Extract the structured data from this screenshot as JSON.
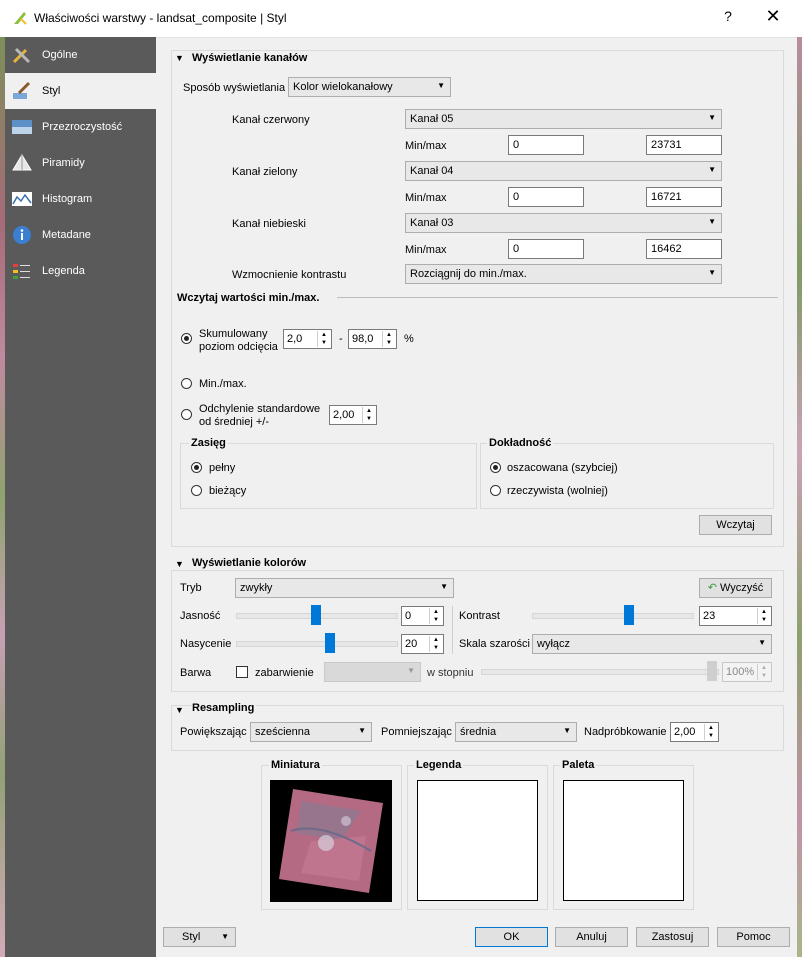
{
  "window": {
    "title": "Właściwości warstwy - landsat_composite | Styl",
    "help": "?",
    "close": "✕"
  },
  "sidebar": {
    "items": [
      {
        "label": "Ogólne",
        "icon": "tools-icon"
      },
      {
        "label": "Styl",
        "icon": "paintbrush-icon"
      },
      {
        "label": "Przezroczystość",
        "icon": "transparency-icon"
      },
      {
        "label": "Piramidy",
        "icon": "pyramid-icon"
      },
      {
        "label": "Histogram",
        "icon": "histogram-icon"
      },
      {
        "label": "Metadane",
        "icon": "info-icon"
      },
      {
        "label": "Legenda",
        "icon": "legend-icon"
      }
    ]
  },
  "band": {
    "header": "Wyświetlanie kanałów",
    "render_label": "Sposób wyświetlania",
    "render_value": "Kolor wielokanałowy",
    "red_label": "Kanał czerwony",
    "red_value": "Kanał 05",
    "green_label": "Kanał zielony",
    "green_value": "Kanał 04",
    "blue_label": "Kanał niebieski",
    "blue_value": "Kanał 03",
    "minmax_label": "Min/max",
    "red_min": "0",
    "red_max": "23731",
    "green_min": "0",
    "green_max": "16721",
    "blue_min": "0",
    "blue_max": "16462",
    "contrast_label": "Wzmocnienie kontrastu",
    "contrast_value": "Rozciągnij do min./max."
  },
  "load": {
    "header": "Wczytaj wartości min./max.",
    "cumulative_line1": "Skumulowany",
    "cumulative_line2": "poziom odcięcia",
    "cum_low": "2,0",
    "dash": "-",
    "cum_high": "98,0",
    "percent": "%",
    "minmax_option": "Min./max.",
    "stddev_line1": "Odchylenie standardowe",
    "stddev_line2": "od średniej +/-",
    "stddev_value": "2,00",
    "extent_title": "Zasięg",
    "extent_full": "pełny",
    "extent_current": "bieżący",
    "accuracy_title": "Dokładność",
    "accuracy_estimate": "oszacowana (szybciej)",
    "accuracy_actual": "rzeczywista (wolniej)",
    "load_button": "Wczytaj"
  },
  "color": {
    "header": "Wyświetlanie kolorów",
    "mode_label": "Tryb",
    "mode_value": "zwykły",
    "reset_button": "Wyczyść",
    "brightness_label": "Jasność",
    "brightness_value": "0",
    "brightness_level": 0.5,
    "contrast_label": "Kontrast",
    "contrast_value": "23",
    "contrast_level": 0.61,
    "saturation_label": "Nasycenie",
    "saturation_value": "20",
    "saturation_level": 0.6,
    "grayscale_label": "Skala szarości",
    "grayscale_value": "wyłącz",
    "hue_label": "Barwa",
    "colorize_label": "zabarwienie",
    "strength_label": "w stopniu",
    "strength_value": "100%"
  },
  "resampling": {
    "header": "Resampling",
    "zoomin_label": "Powiększając",
    "zoomin_value": "sześcienna",
    "zoomout_label": "Pomniejszając",
    "zoomout_value": "średnia",
    "oversampling_label": "Nadpróbkowanie",
    "oversampling_value": "2,00"
  },
  "preview": {
    "thumbnail_title": "Miniatura",
    "legend_title": "Legenda",
    "palette_title": "Paleta"
  },
  "footer": {
    "style_button": "Styl",
    "ok": "OK",
    "cancel": "Anuluj",
    "apply": "Zastosuj",
    "help": "Pomoc"
  }
}
